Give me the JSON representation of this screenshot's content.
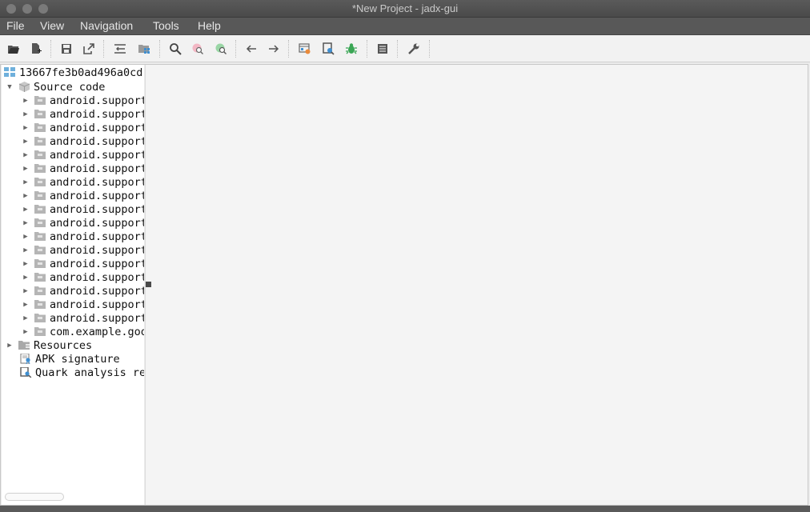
{
  "window": {
    "title": "*New Project - jadx-gui"
  },
  "menu": [
    "File",
    "View",
    "Navigation",
    "Tools",
    "Help"
  ],
  "toolbar": {
    "icons": [
      "open-file-icon",
      "add-files-icon",
      "save-all-icon",
      "export-icon",
      "sync-icon",
      "flatten-packages-icon",
      "search-icon",
      "find-usage-icon",
      "find-deobf-icon",
      "back-icon",
      "forward-icon",
      "deobfuscation-icon",
      "quark-icon",
      "debug-icon",
      "log-viewer-icon",
      "preferences-icon"
    ]
  },
  "tree": {
    "root": "13667fe3b0ad496a0cd",
    "source_code": "Source code",
    "packages": [
      "android.support",
      "android.support",
      "android.support",
      "android.support",
      "android.support",
      "android.support",
      "android.support",
      "android.support",
      "android.support",
      "android.support",
      "android.support",
      "android.support",
      "android.support",
      "android.support",
      "android.support",
      "android.support",
      "android.support",
      "com.example.goo"
    ],
    "resources": "Resources",
    "apk_signature": "APK signature",
    "quark": "Quark analysis re"
  },
  "colors": {
    "titlebar": "#4f4f4f",
    "menubar": "#585858",
    "folder": "#a0a0a0",
    "quark_green": "#3aa655"
  }
}
